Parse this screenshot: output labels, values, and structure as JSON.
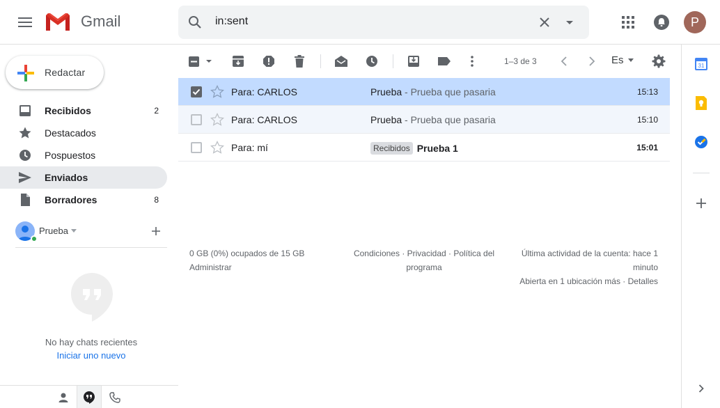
{
  "header": {
    "app_name": "Gmail",
    "search_value": "in:sent",
    "avatar_letter": "P"
  },
  "sidebar": {
    "compose_label": "Redactar",
    "items": [
      {
        "label": "Recibidos",
        "count": "2",
        "icon": "inbox-icon",
        "bold": true
      },
      {
        "label": "Destacados",
        "count": "",
        "icon": "star-icon",
        "bold": false
      },
      {
        "label": "Pospuestos",
        "count": "",
        "icon": "clock-icon",
        "bold": false
      },
      {
        "label": "Enviados",
        "count": "",
        "icon": "send-icon",
        "bold": true,
        "active": true
      },
      {
        "label": "Borradores",
        "count": "8",
        "icon": "draft-icon",
        "bold": true
      }
    ]
  },
  "hangouts": {
    "user_name": "Prueba",
    "no_chats": "No hay chats recientes",
    "start_new": "Iniciar uno nuevo"
  },
  "toolbar": {
    "page_info": "1–3 de 3",
    "lang": "Es"
  },
  "emails": [
    {
      "sender": "Para: CARLOS",
      "tag": "",
      "subject": "Prueba",
      "snippet": " - Prueba que pasaria",
      "time": "15:13",
      "selected": true,
      "unread": false
    },
    {
      "sender": "Para: CARLOS",
      "tag": "",
      "subject": "Prueba",
      "snippet": " - Prueba que pasaria",
      "time": "15:10",
      "selected": false,
      "unread": false
    },
    {
      "sender": "Para: mí",
      "tag": "Recibidos",
      "subject": "Prueba 1",
      "snippet": "",
      "time": "15:01",
      "selected": false,
      "unread": true
    }
  ],
  "footer": {
    "storage": "0 GB (0%) ocupados de 15 GB",
    "manage": "Administrar",
    "terms_line1": "Condiciones · Privacidad · Política del",
    "terms_line2": "programa",
    "activity_line1": "Última actividad de la cuenta: hace 1",
    "activity_line2": "minuto",
    "activity_line3": "Abierta en 1 ubicación más · Detalles"
  },
  "colors": {
    "selected_row": "#c2dbff",
    "active_nav": "#e8eaed",
    "link": "#1a73e8",
    "avatar": "#a0675a"
  }
}
